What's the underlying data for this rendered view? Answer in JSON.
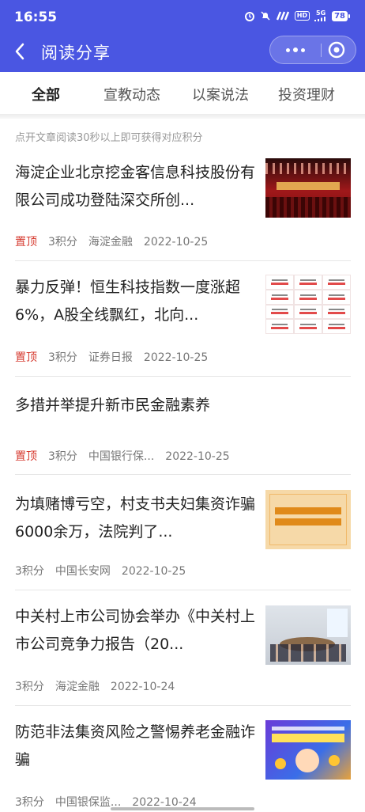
{
  "status_bar": {
    "time": "16:55",
    "network_label": "5G",
    "hd_label": "HD",
    "battery": "78"
  },
  "nav": {
    "title": "阅读分享"
  },
  "tabs": [
    {
      "label": "全部",
      "active": true
    },
    {
      "label": "宣教动态",
      "active": false
    },
    {
      "label": "以案说法",
      "active": false
    },
    {
      "label": "投资理财",
      "active": false
    }
  ],
  "notice": "点开文章阅读30秒以上即可获得对应积分",
  "articles": [
    {
      "title": "海淀企业北京挖金客信息科技股份有限公司成功登陆深交所创...",
      "pinned_label": "置顶",
      "points": "3积分",
      "source": "海淀金融",
      "date": "2022-10-25",
      "thumb": "ceremony-stage-photo"
    },
    {
      "title": "暴力反弹！恒生科技指数一度涨超6%，A股全线飘红，北向...",
      "pinned_label": "置顶",
      "points": "3积分",
      "source": "证券日报",
      "date": "2022-10-25",
      "thumb": "market-index-table"
    },
    {
      "title": "多措并举提升新市民金融素养",
      "pinned_label": "置顶",
      "points": "3积分",
      "source": "中国银行保...",
      "date": "2022-10-25",
      "thumb": ""
    },
    {
      "title": "为填赌博亏空，村支书夫妇集资诈骗6000余万，法院判了...",
      "pinned_label": "",
      "points": "3积分",
      "source": "中国长安网",
      "date": "2022-10-25",
      "thumb": "notice-poster"
    },
    {
      "title": "中关村上市公司协会举办《中关村上市公司竞争力报告（20...",
      "pinned_label": "",
      "points": "3积分",
      "source": "海淀金融",
      "date": "2022-10-24",
      "thumb": "meeting-photo"
    },
    {
      "title": "防范非法集资风险之警惕养老金融诈骗",
      "pinned_label": "",
      "points": "3积分",
      "source": "中国银保监...",
      "date": "2022-10-24",
      "thumb": "anti-fraud-poster"
    }
  ],
  "colors": {
    "header_bg": "#4a56e2",
    "pinned": "#d63a2f",
    "meta": "#777777"
  }
}
